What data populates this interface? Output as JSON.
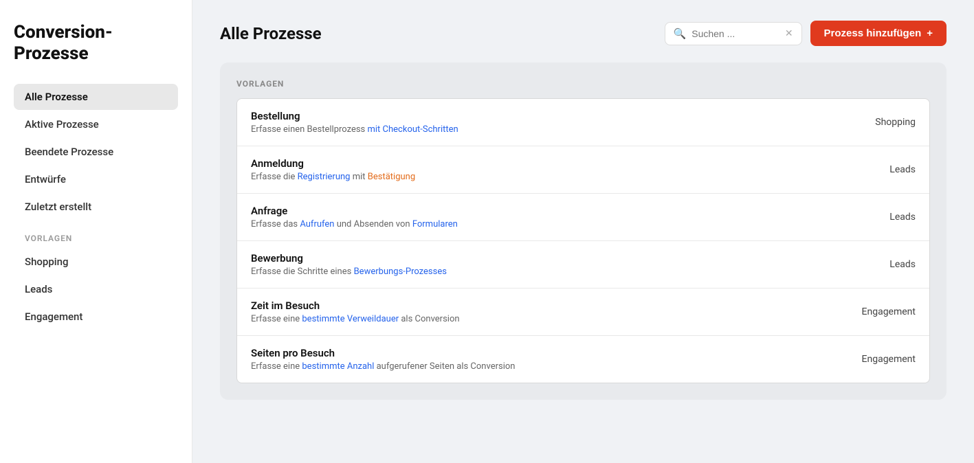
{
  "sidebar": {
    "title": "Conversion-\nProzesse",
    "nav_items": [
      {
        "id": "alle-prozesse",
        "label": "Alle Prozesse",
        "active": true
      },
      {
        "id": "aktive-prozesse",
        "label": "Aktive Prozesse",
        "active": false
      },
      {
        "id": "beendete-prozesse",
        "label": "Beendete Prozesse",
        "active": false
      },
      {
        "id": "entwuerfe",
        "label": "Entwürfe",
        "active": false
      },
      {
        "id": "zuletzt-erstellt",
        "label": "Zuletzt erstellt",
        "active": false
      }
    ],
    "templates_label": "VORLAGEN",
    "template_items": [
      {
        "id": "shopping",
        "label": "Shopping",
        "active": false
      },
      {
        "id": "leads",
        "label": "Leads",
        "active": false
      },
      {
        "id": "engagement",
        "label": "Engagement",
        "active": false
      }
    ]
  },
  "header": {
    "title": "Alle Prozesse",
    "search_placeholder": "Suchen ...",
    "add_button_label": "Prozess hinzufügen"
  },
  "content": {
    "section_label": "VORLAGEN",
    "processes": [
      {
        "name": "Bestellung",
        "description_plain": "Erfasse einen Bestellprozess ",
        "description_link1": "mit",
        "description_link1_text": " mit ",
        "link_text": "Checkout-Schritten",
        "description_text": "Erfasse einen Bestellprozess mit Checkout-Schritten",
        "desc_before": "Erfasse einen Bestellprozess ",
        "desc_link": "mit Checkout-Schritten",
        "desc_link_color": "blue",
        "category": "Shopping"
      },
      {
        "name": "Anmeldung",
        "description_text": "Erfasse die Registrierung mit Bestätigung",
        "desc_before": "Erfasse die ",
        "desc_link": "Registrierung",
        "desc_link_color": "blue",
        "desc_middle": " mit ",
        "desc_link2": "Bestätigung",
        "desc_link2_color": "orange",
        "category": "Leads"
      },
      {
        "name": "Anfrage",
        "description_text": "Erfasse das Aufrufen und Absenden von Formularen",
        "desc_before": "Erfasse das ",
        "desc_link": "Aufrufen",
        "desc_link_color": "blue",
        "desc_middle": " und Absenden von ",
        "desc_link2": "Formularen",
        "desc_link2_color": "blue",
        "category": "Leads"
      },
      {
        "name": "Bewerbung",
        "description_text": "Erfasse die Schritte eines Bewerbungs-Prozesses",
        "desc_before": "Erfasse die Schritte eines ",
        "desc_link": "Bewerbungs-Prozesses",
        "desc_link_color": "blue",
        "category": "Leads"
      },
      {
        "name": "Zeit im Besuch",
        "description_text": "Erfasse eine bestimmte Verweildauer als Conversion",
        "desc_before": "Erfasse eine ",
        "desc_link": "bestimmte Verweildauer",
        "desc_link_color": "blue",
        "desc_middle": " als Conversion",
        "category": "Engagement"
      },
      {
        "name": "Seiten pro Besuch",
        "description_text": "Erfasse eine bestimmte Anzahl aufgerufener Seiten als Conversion",
        "desc_before": "Erfasse eine ",
        "desc_link": "bestimmte Anzahl",
        "desc_link_color": "blue",
        "desc_middle": " aufgerufener Seiten als Conversion",
        "category": "Engagement"
      }
    ]
  }
}
